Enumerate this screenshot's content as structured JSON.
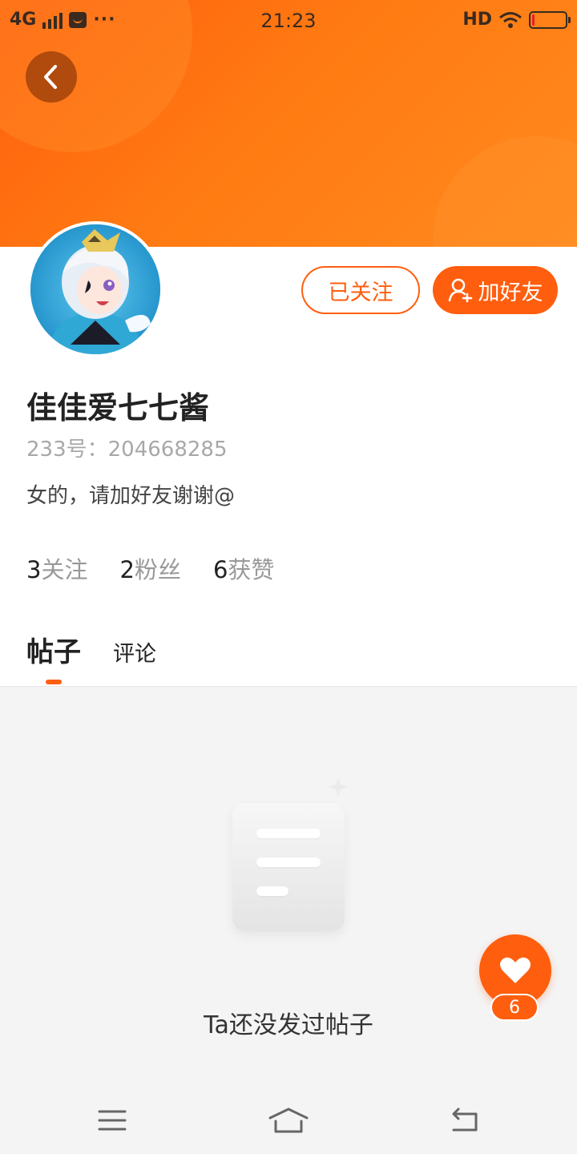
{
  "status_bar": {
    "network": "4G",
    "time": "21:23",
    "hd": "HD",
    "more_dots": "···",
    "battery_level": 0.08,
    "battery_color": "#e8202a"
  },
  "header": {
    "gradient_colors": [
      "#ff5e0e",
      "#ff8a1e"
    ]
  },
  "profile": {
    "actions": {
      "followed_label": "已关注",
      "add_friend_label": "加好友"
    },
    "username": "佳佳爱七七酱",
    "uid_text": "233号：204668285",
    "bio": "女的，请加好友谢谢@",
    "stats": [
      {
        "num": "3",
        "label": "关注"
      },
      {
        "num": "2",
        "label": "粉丝"
      },
      {
        "num": "6",
        "label": "获赞"
      }
    ]
  },
  "tabs": {
    "posts": "帖子",
    "comments": "评论",
    "active": "posts"
  },
  "empty_state": {
    "text": "Ta还没发过帖子"
  },
  "like_fab": {
    "count": "6"
  },
  "nav": {
    "icons": [
      "menu-icon",
      "home-icon",
      "back-icon"
    ]
  },
  "accent_color": "#ff5e0e"
}
